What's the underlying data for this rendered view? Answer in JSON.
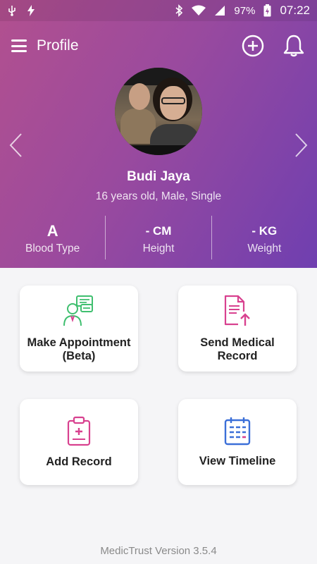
{
  "status_bar": {
    "battery": "97%",
    "time": "07:22",
    "icons": [
      "usb-icon",
      "flash-icon",
      "bluetooth-icon",
      "wifi-icon",
      "signal-icon",
      "battery-charging-icon"
    ]
  },
  "toolbar": {
    "title": "Profile",
    "icons": [
      "menu-icon",
      "add-icon",
      "bell-icon"
    ]
  },
  "profile": {
    "name": "Budi Jaya",
    "details": "16 years old, Male, Single"
  },
  "stats": [
    {
      "value": "A",
      "label": "Blood Type"
    },
    {
      "value": "- CM",
      "label": "Height"
    },
    {
      "value": "- KG",
      "label": "Weight"
    }
  ],
  "cards": [
    {
      "label": "Make Appointment (Beta)",
      "icon": "appointment-icon"
    },
    {
      "label": "Send Medical Record",
      "icon": "send-record-icon"
    },
    {
      "label": "Add Record",
      "icon": "add-record-icon"
    },
    {
      "label": "View Timeline",
      "icon": "timeline-icon"
    }
  ],
  "footer": {
    "version": "MedicTrust Version 3.5.4"
  },
  "colors": {
    "header_start": "#b2508f",
    "header_end": "#6f3fb0",
    "green": "#3fbf6f",
    "pink": "#d8418f",
    "blue": "#3b6fd8"
  }
}
